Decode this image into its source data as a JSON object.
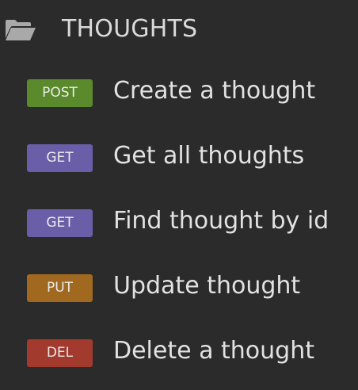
{
  "folder": {
    "icon": "folder-open-icon",
    "label": "THOUGHTS"
  },
  "requests": [
    {
      "method": "POST",
      "method_color": "#5a8a2c",
      "label": "Create a thought"
    },
    {
      "method": "GET",
      "method_color": "#6a5ea8",
      "label": "Get all thoughts"
    },
    {
      "method": "GET",
      "method_color": "#6a5ea8",
      "label": "Find thought by id"
    },
    {
      "method": "PUT",
      "method_color": "#a0691f",
      "label": "Update thought"
    },
    {
      "method": "DEL",
      "method_color": "#a23a2e",
      "label": "Delete a thought"
    }
  ]
}
